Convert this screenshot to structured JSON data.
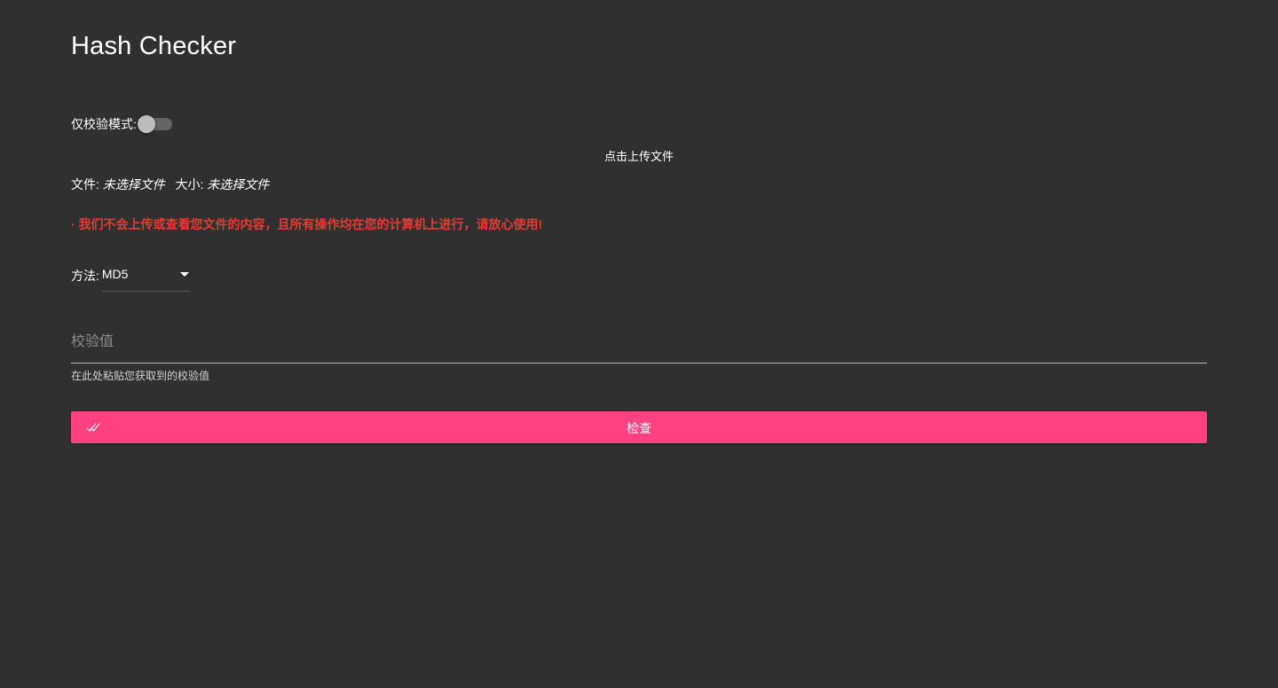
{
  "app": {
    "title": "Hash Checker"
  },
  "mode": {
    "label": "仅校验模式:",
    "enabled": false
  },
  "upload": {
    "label": "点击上传文件"
  },
  "file_info": {
    "file_label": "文件:",
    "file_value": "未选择文件",
    "size_label": "大小:",
    "size_value": "未选择文件"
  },
  "notice": {
    "text": "· 我们不会上传或查看您文件的内容，且所有操作均在您的计算机上进行，请放心使用!"
  },
  "method": {
    "label": "方法:",
    "selected": "MD5"
  },
  "hash_input": {
    "placeholder": "校验值",
    "value": "",
    "helper": "在此处粘贴您获取到的校验值"
  },
  "check_button": {
    "label": "检查",
    "icon": "double-check-icon"
  },
  "colors": {
    "background": "#303030",
    "accent": "#ff4081",
    "warning": "#e53935"
  }
}
